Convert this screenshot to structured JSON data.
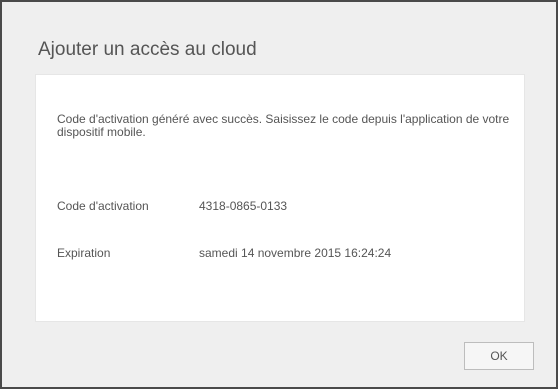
{
  "dialog": {
    "title": "Ajouter un accès au cloud",
    "message": "Code d'activation généré avec succès. Saisissez le code depuis l'application de votre dispositif mobile.",
    "fields": {
      "code_label": "Code d'activation",
      "code_value": "4318-0865-0133",
      "expiration_label": "Expiration",
      "expiration_value": "samedi 14 novembre 2015 16:24:24"
    },
    "ok_label": "OK"
  }
}
